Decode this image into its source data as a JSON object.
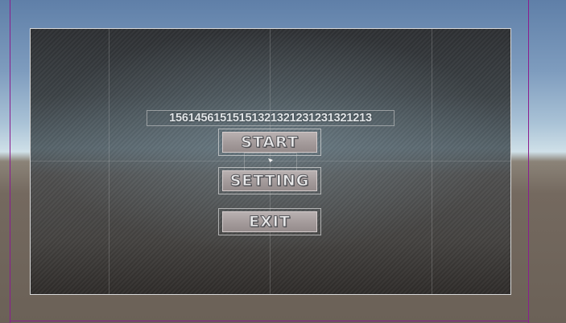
{
  "score_text": "1561456151515132132123123132121 3",
  "menu": {
    "start_label": "START",
    "setting_label": "SETTING",
    "exit_label": "EXIT"
  },
  "colors": {
    "frame_border": "#8a1d8f",
    "button_face": "#a59c9c",
    "label_text": "#e9e9ea"
  }
}
